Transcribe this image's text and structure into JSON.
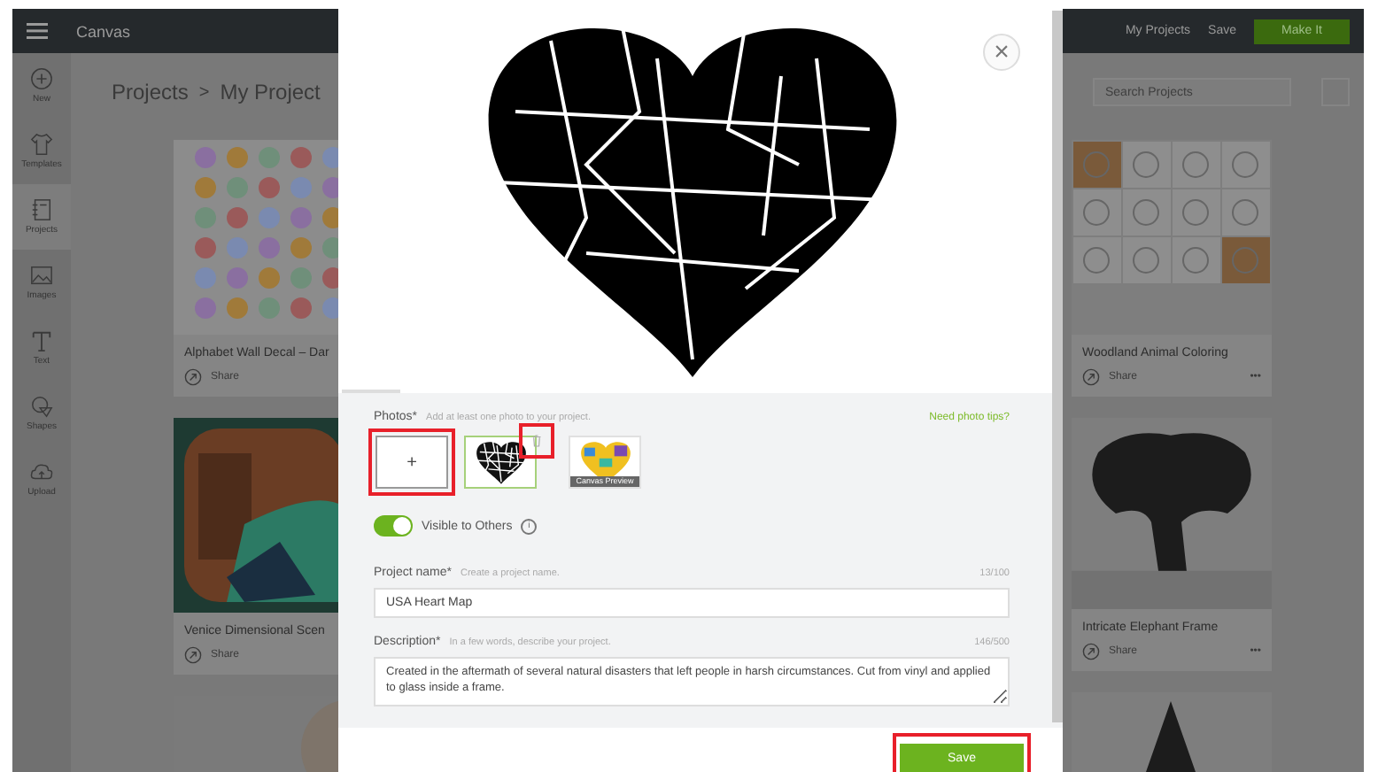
{
  "app": {
    "title": "Canvas",
    "header_links": [
      "My Projects",
      "Save"
    ],
    "make_button": "Make It"
  },
  "sidebar": [
    {
      "label": "New",
      "kind": "new",
      "selected": false
    },
    {
      "label": "Templates",
      "kind": "templates",
      "selected": false
    },
    {
      "label": "Projects",
      "kind": "projects",
      "selected": true
    },
    {
      "label": "Images",
      "kind": "images",
      "selected": false
    },
    {
      "label": "Text",
      "kind": "text",
      "selected": false
    },
    {
      "label": "Shapes",
      "kind": "shapes",
      "selected": false
    },
    {
      "label": "Upload",
      "kind": "upload",
      "selected": false
    }
  ],
  "breadcrumb": {
    "root": "Projects",
    "separator": ">",
    "current": "My Project"
  },
  "search": {
    "placeholder": "Search Projects"
  },
  "left_cards": [
    {
      "title": "Alphabet Wall Decal – Dar",
      "share": "Share"
    },
    {
      "title": "Venice Dimensional Scen",
      "share": "Share"
    },
    {
      "kind": "picture"
    }
  ],
  "right_cards": [
    {
      "title": "Woodland Animal Coloring",
      "share": "Share",
      "more": "•••"
    },
    {
      "title": "Intricate Elephant Frame",
      "share": "Share",
      "more": "•••"
    },
    {
      "kind": "picture"
    }
  ],
  "modal": {
    "close": "×",
    "photos": {
      "label": "Photos*",
      "hint": "Add at least one photo to your project.",
      "tips_link": "Need photo tips?",
      "add": "+",
      "thumbnails": [
        {
          "kind": "heart",
          "selected": true
        },
        {
          "kind": "preview",
          "caption": "Canvas Preview",
          "selected": false
        }
      ]
    },
    "visible": {
      "label": "Visible to Others",
      "on": true,
      "info": "i"
    },
    "project_name": {
      "label": "Project name*",
      "hint": "Create a project name.",
      "counter": "13/100",
      "value": "USA Heart Map"
    },
    "description": {
      "label": "Description*",
      "hint": "In a few words, describe your project.",
      "counter": "146/500",
      "value": "Created in the aftermath of several natural disasters that left people in harsh circumstances. Cut from vinyl and applied to glass inside a frame."
    },
    "save": "Save"
  }
}
